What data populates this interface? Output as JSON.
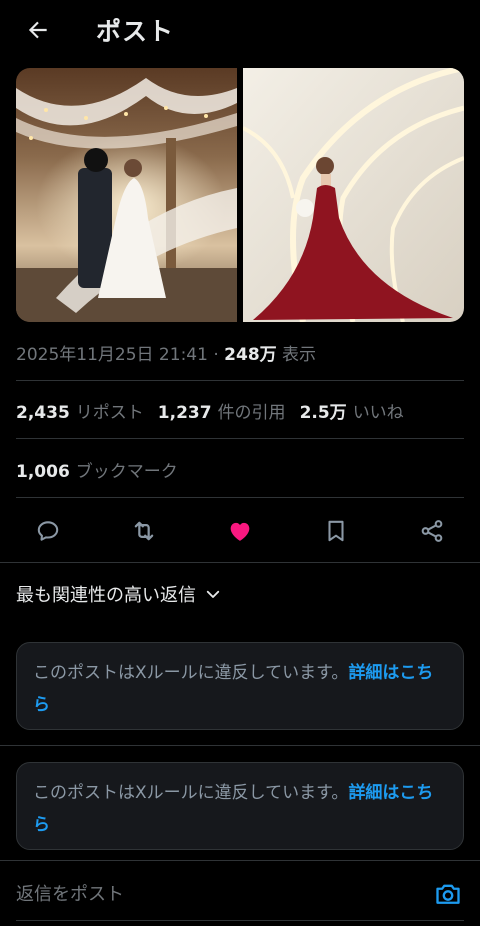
{
  "header": {
    "title": "ポスト"
  },
  "post": {
    "timestamp": "2025年11月25日 21:41",
    "separator": " · ",
    "views_count": "248万",
    "views_label": " 表示",
    "stats": {
      "reposts_count": "2,435",
      "reposts_label": "リポスト",
      "quotes_count": "1,237",
      "quotes_label": "件の引用",
      "likes_count": "2.5万",
      "likes_label": "いいね",
      "bookmarks_count": "1,006",
      "bookmarks_label": "ブックマーク"
    }
  },
  "actions": [
    "reply-icon",
    "repost-icon",
    "like-icon",
    "bookmark-icon",
    "share-icon"
  ],
  "sort": {
    "label": "最も関連性の高い返信"
  },
  "notices": [
    {
      "text": "このポストはXルールに違反しています。",
      "link": "詳細はこちら"
    },
    {
      "text": "このポストはXルールに違反しています。",
      "link": "詳細はこちら"
    }
  ],
  "reply": {
    "placeholder": "返信をポスト"
  },
  "colors": {
    "background": "#000000",
    "like": "#f91880",
    "link": "#1d9bf0",
    "muted": "#71767b"
  }
}
